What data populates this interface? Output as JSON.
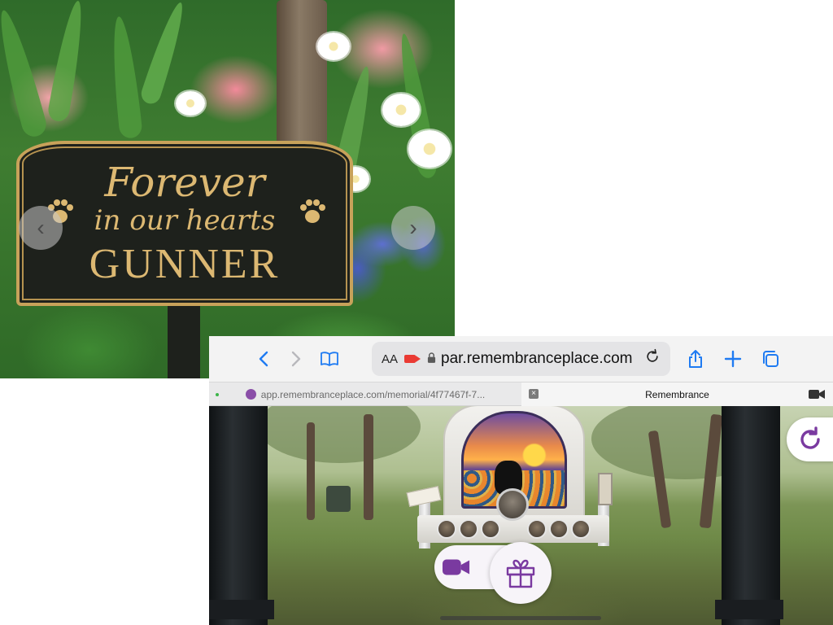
{
  "plaque_photo": {
    "line1": "Forever",
    "line2": "in our hearts",
    "name": "GUNNER",
    "prev_glyph": "‹",
    "next_glyph": "›",
    "colors": {
      "plaque": "#1e211c",
      "gold": "#dcb872"
    }
  },
  "browser": {
    "address_bar": {
      "text_size_label": "AA",
      "url": "par.remembranceplace.com"
    },
    "tabs": [
      {
        "label": "app.remembranceplace.com/memorial/4f77467f-7..."
      },
      {
        "label": "Remembrance"
      }
    ],
    "toolbar_icons": [
      "back-icon",
      "forward-icon",
      "bookmarks-icon",
      "share-icon",
      "new-tab-icon",
      "tabs-overview-icon"
    ],
    "accent": "#1f7bf2"
  },
  "page": {
    "action_icons": [
      "video-camera-icon",
      "gift-icon",
      "refresh-icon"
    ],
    "accent": "#7a3aa0"
  }
}
